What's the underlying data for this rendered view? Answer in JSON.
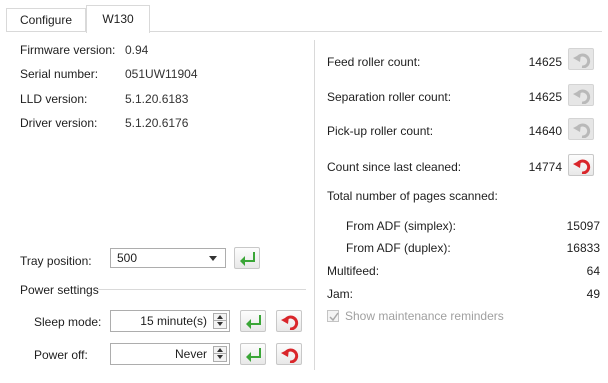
{
  "tabs": {
    "configure": "Configure",
    "device": "W130"
  },
  "info": {
    "firmware_label": "Firmware version:",
    "firmware_value": "0.94",
    "serial_label": "Serial number:",
    "serial_value": "051UW11904",
    "lld_label": "LLD version:",
    "lld_value": "5.1.20.6183",
    "driver_label": "Driver version:",
    "driver_value": "5.1.20.6176"
  },
  "tray": {
    "label": "Tray position:",
    "value": "500"
  },
  "power": {
    "group_label": "Power settings",
    "sleep_label": "Sleep mode:",
    "sleep_value": "15 minute(s)",
    "off_label": "Power off:",
    "off_value": "Never"
  },
  "counters": {
    "feed_label": "Feed roller count:",
    "feed_value": "14625",
    "separation_label": "Separation roller count:",
    "separation_value": "14625",
    "pickup_label": "Pick-up roller count:",
    "pickup_value": "14640",
    "cleaned_label": "Count since last cleaned:",
    "cleaned_value": "14774",
    "total_label": "Total number of pages scanned:",
    "adf_simplex_label": "From ADF (simplex):",
    "adf_simplex_value": "15097",
    "adf_duplex_label": "From ADF (duplex):",
    "adf_duplex_value": "16833",
    "multifeed_label": "Multifeed:",
    "multifeed_value": "64",
    "jam_label": "Jam:",
    "jam_value": "49",
    "reminders_label": "Show maintenance reminders"
  },
  "colors": {
    "apply_green": "#3aa637",
    "reset_red": "#d9262b",
    "disabled": "#a0a0a0"
  }
}
